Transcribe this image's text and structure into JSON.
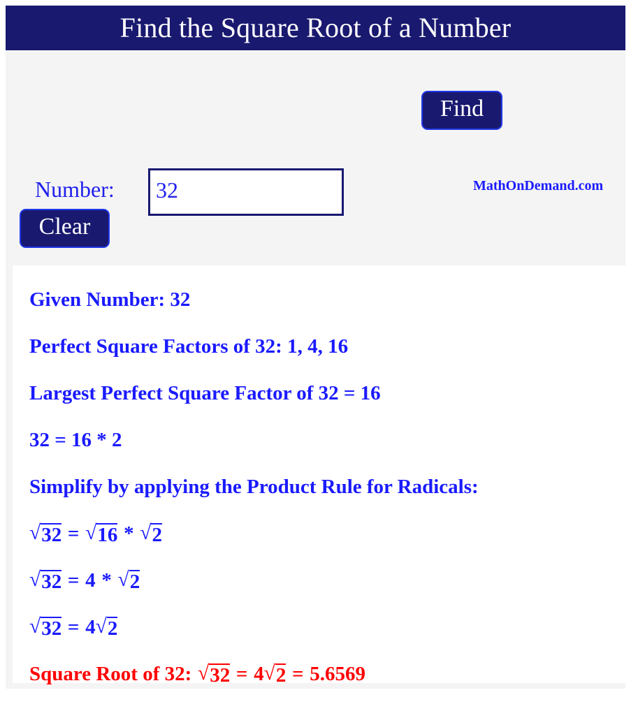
{
  "header": {
    "title": "Find the Square Root of a Number"
  },
  "form": {
    "number_label": "Number:",
    "number_value": "32",
    "number_placeholder": "",
    "find_label": "Find",
    "clear_label": "Clear"
  },
  "brand": {
    "text": "MathOnDemand.com"
  },
  "results": {
    "given_number": "Given Number: 32",
    "perfect_square_factors": "Perfect Square Factors of 32: 1, 4, 16",
    "largest_factor": "Largest Perfect Square Factor of 32 = 16",
    "factorization": "32 = 16 * 2",
    "simplify_note": "Simplify by applying the Product Rule for Radicals:",
    "eq1": {
      "lhs_radicand": "32",
      "eq": "=",
      "r1_radicand": "16",
      "times": "*",
      "r2_radicand": "2"
    },
    "eq2": {
      "lhs_radicand": "32",
      "eq": "=",
      "coef": "4",
      "times": "*",
      "radicand": "2"
    },
    "eq3": {
      "lhs_radicand": "32",
      "eq": "=",
      "coef": "4",
      "radicand": "2"
    },
    "final": {
      "prefix": "Square Root of 32:",
      "lhs_radicand": "32",
      "eq1": "=",
      "coef": "4",
      "radicand": "2",
      "eq2": "=",
      "decimal": "5.6569"
    }
  },
  "colors": {
    "header_bg": "#191970",
    "accent_blue": "#1a1aff",
    "answer_red": "#fe0000",
    "page_bg": "#f4f4f4",
    "panel_bg": "#ffffff"
  },
  "symbols": {
    "radical": "√"
  }
}
